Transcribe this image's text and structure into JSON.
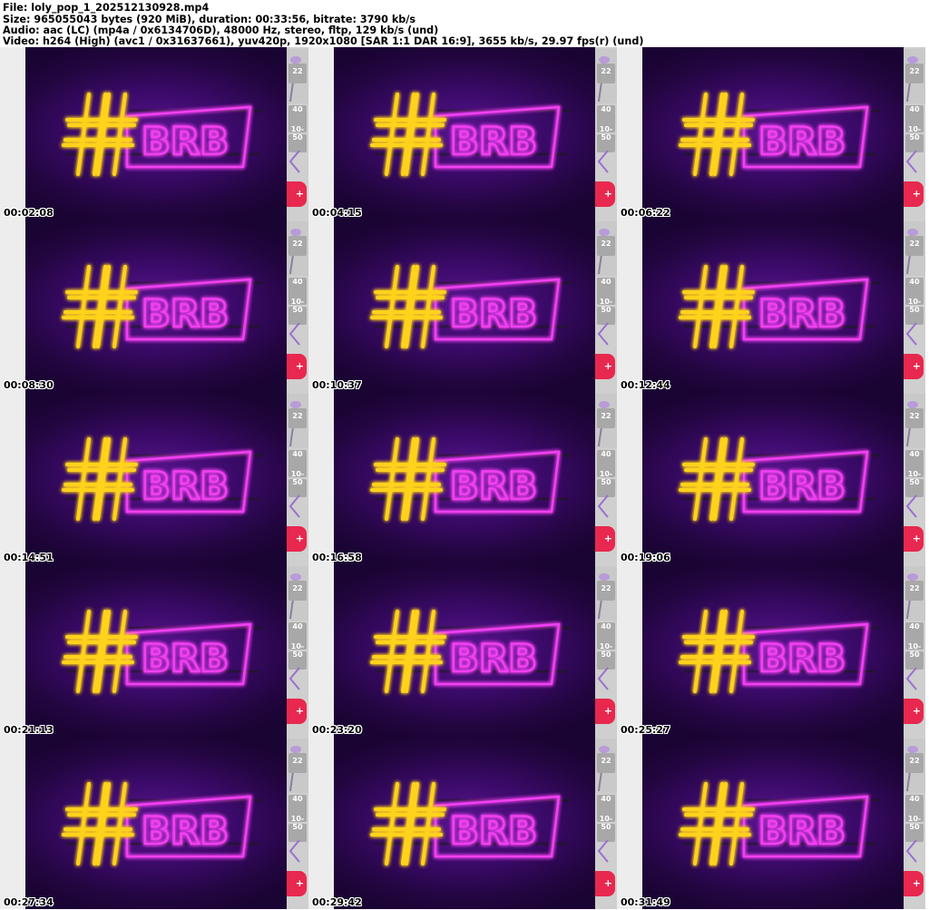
{
  "header": {
    "file_line": "File: loly_pop_1_202512130928.mp4",
    "size_line": "Size: 965055043 bytes (920 MiB), duration: 00:33:56, bitrate: 3790 kb/s",
    "audio_line": "Audio: aac (LC) (mp4a / 0x6134706D), 48000 Hz, stereo, fltp, 129 kb/s (und)",
    "video_line": "Video: h264 (High) (avc1 / 0x31637661), yuv420p, 1920x1080 [SAR 1:1 DAR 16:9], 3655 kb/s, 29.97 fps(r) (und)"
  },
  "sign": {
    "text": "BRB",
    "hash": "#"
  },
  "colors": {
    "neon_yellow": "#ffd21a",
    "neon_magenta": "#f040f0",
    "bg_purple": "#3a0a68",
    "pill_red": "#e8284e"
  },
  "side": {
    "values": [
      "22",
      "40",
      "10-50"
    ],
    "pill": "+"
  },
  "thumbnails": [
    {
      "time": "00:02:08"
    },
    {
      "time": "00:04:15"
    },
    {
      "time": "00:06:22"
    },
    {
      "time": "00:08:30"
    },
    {
      "time": "00:10:37"
    },
    {
      "time": "00:12:44"
    },
    {
      "time": "00:14:51"
    },
    {
      "time": "00:16:58"
    },
    {
      "time": "00:19:06"
    },
    {
      "time": "00:21:13"
    },
    {
      "time": "00:23:20"
    },
    {
      "time": "00:25:27"
    },
    {
      "time": "00:27:34"
    },
    {
      "time": "00:29:42"
    },
    {
      "time": "00:31:49"
    }
  ]
}
